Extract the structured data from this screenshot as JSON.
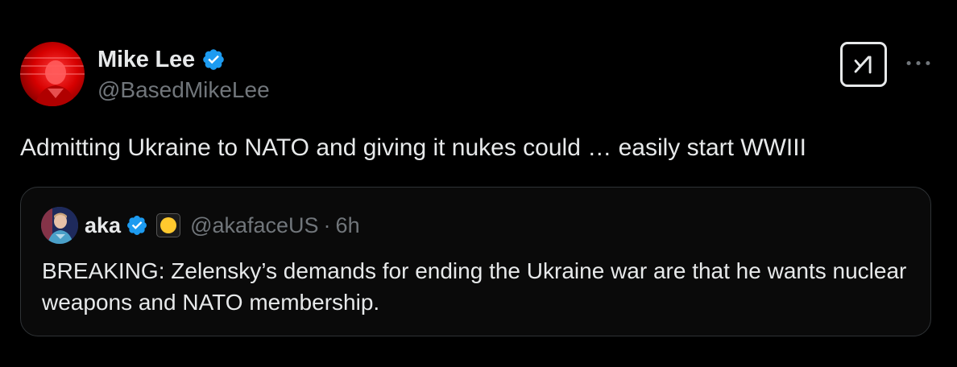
{
  "tweet": {
    "author": {
      "display_name": "Mike Lee",
      "handle": "@BasedMikeLee",
      "verified": true,
      "verified_color": "#1d9bf0",
      "avatar_icon": "avatar-photo-red"
    },
    "text": "Admitting Ukraine to NATO and giving it nukes could … easily start WWIII",
    "grok_icon": "grok-icon",
    "more_icon": "more-icon"
  },
  "quoted_tweet": {
    "author": {
      "display_name": "aka",
      "handle": "@akafaceUS",
      "verified": true,
      "affiliate_badge_icon": "yellow-circle-badge-icon"
    },
    "separator": "·",
    "time": "6h",
    "text": "BREAKING: Zelensky’s demands for ending the Ukraine war are that he wants nuclear weapons and NATO membership."
  },
  "colors": {
    "background": "#000000",
    "primary_text": "#e7e9ea",
    "secondary_text": "#71767b",
    "border": "#2f3336",
    "verified_blue": "#1d9bf0"
  }
}
